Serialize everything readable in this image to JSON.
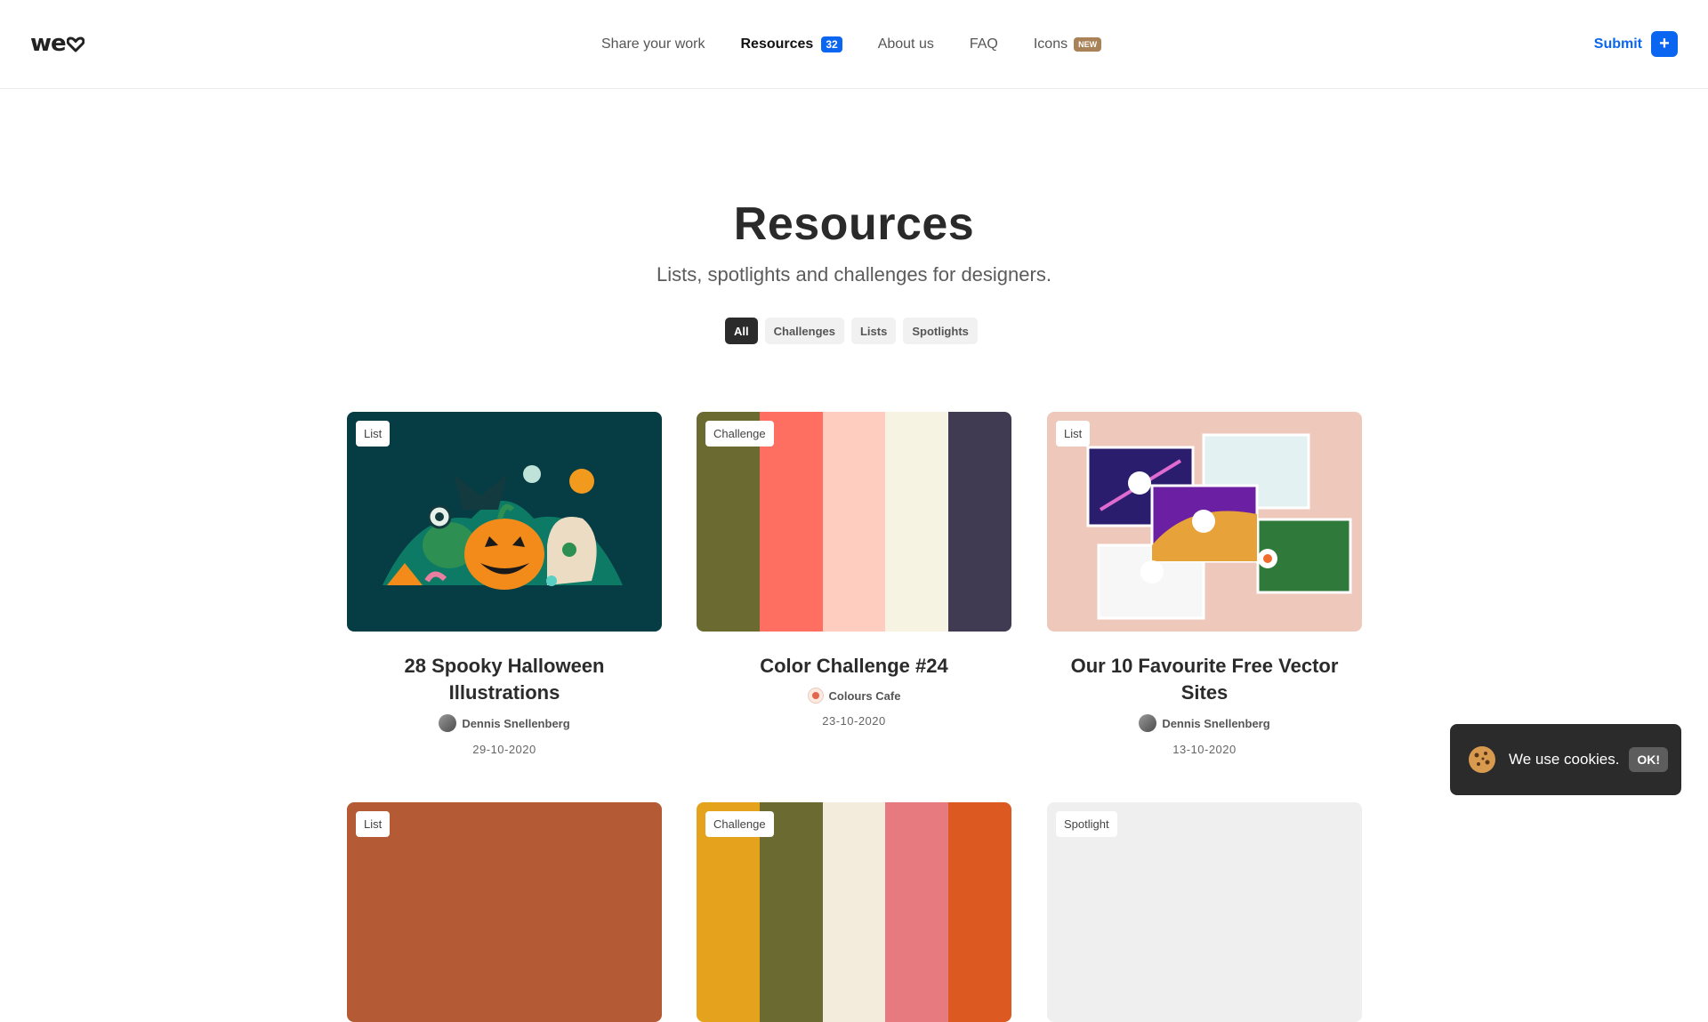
{
  "header": {
    "logo": "we",
    "nav": [
      {
        "label": "Share your work"
      },
      {
        "label": "Resources",
        "badge": "32"
      },
      {
        "label": "About us"
      },
      {
        "label": "FAQ"
      },
      {
        "label": "Icons",
        "badge": "NEW"
      }
    ],
    "submit_label": "Submit",
    "submit_icon": "+"
  },
  "hero": {
    "title": "Resources",
    "subtitle": "Lists, spotlights and challenges for designers."
  },
  "filters": [
    "All",
    "Challenges",
    "Lists",
    "Spotlights"
  ],
  "cards": [
    {
      "tag": "List",
      "title": "28 Spooky Halloween Illustrations",
      "author": "Dennis Snellenberg",
      "date": "29-10-2020"
    },
    {
      "tag": "Challenge",
      "title": "Color Challenge #24",
      "author": "Colours Cafe",
      "date": "23-10-2020",
      "palette": [
        "#6b6b31",
        "#ff6f61",
        "#ffcdc0",
        "#f6f3e3",
        "#403a52"
      ]
    },
    {
      "tag": "List",
      "title": "Our 10 Favourite Free Vector Sites",
      "author": "Dennis Snellenberg",
      "date": "13-10-2020"
    },
    {
      "tag": "List"
    },
    {
      "tag": "Challenge",
      "palette": [
        "#e5a21c",
        "#6b6b31",
        "#f3ebdc",
        "#e67a7e",
        "#dc5a22"
      ]
    },
    {
      "tag": "Spotlight"
    }
  ],
  "cookie": {
    "text": "We use cookies.",
    "ok_label": "OK!"
  }
}
